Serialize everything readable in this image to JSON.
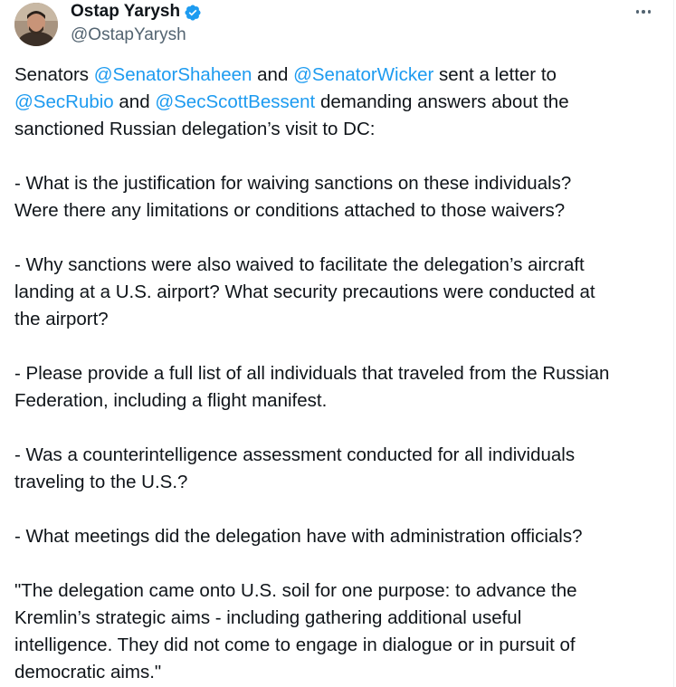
{
  "author": {
    "display_name": "Ostap Yarysh",
    "handle": "@OstapYarysh",
    "verified_icon": "verified-badge-icon",
    "avatar": "avatar"
  },
  "menu": {
    "more_icon": "more-options-icon"
  },
  "tweet": {
    "intro": {
      "t1": "Senators ",
      "m1": "@SenatorShaheen",
      "t2": " and ",
      "m2": "@SenatorWicker",
      "t3": " sent a letter to",
      "m3": "@SecRubio",
      "t4": " and ",
      "m4": "@SecScottBessent",
      "t5": " demanding answers about the",
      "line3": "sanctioned Russian delegation’s visit to DC:"
    },
    "q1": [
      "- What is the justification for waiving sanctions on these individuals?",
      "Were there any limitations or conditions attached to those waivers?"
    ],
    "q2": [
      "- Why sanctions were also waived to facilitate the delegation’s aircraft",
      "landing at a U.S. airport? What security precautions were conducted at",
      "the airport?"
    ],
    "q3": [
      "- Please provide a full list of all individuals that traveled from the Russian",
      "Federation, including a flight manifest."
    ],
    "q4": [
      "- Was a counterintelligence assessment conducted for all individuals",
      "traveling to the U.S.?"
    ],
    "q5": [
      "- What meetings did the delegation have with administration officials?"
    ],
    "quote": [
      "\"The delegation came onto U.S. soil for one purpose: to advance the",
      "Kremlin’s strategic aims - including gathering additional useful",
      "intelligence. They did not come to engage in dialogue or in pursuit of",
      "democratic aims.\""
    ]
  },
  "colors": {
    "link": "#1d9bf0",
    "text": "#0f1419",
    "secondary": "#536471",
    "verified": "#1d9bf0"
  }
}
